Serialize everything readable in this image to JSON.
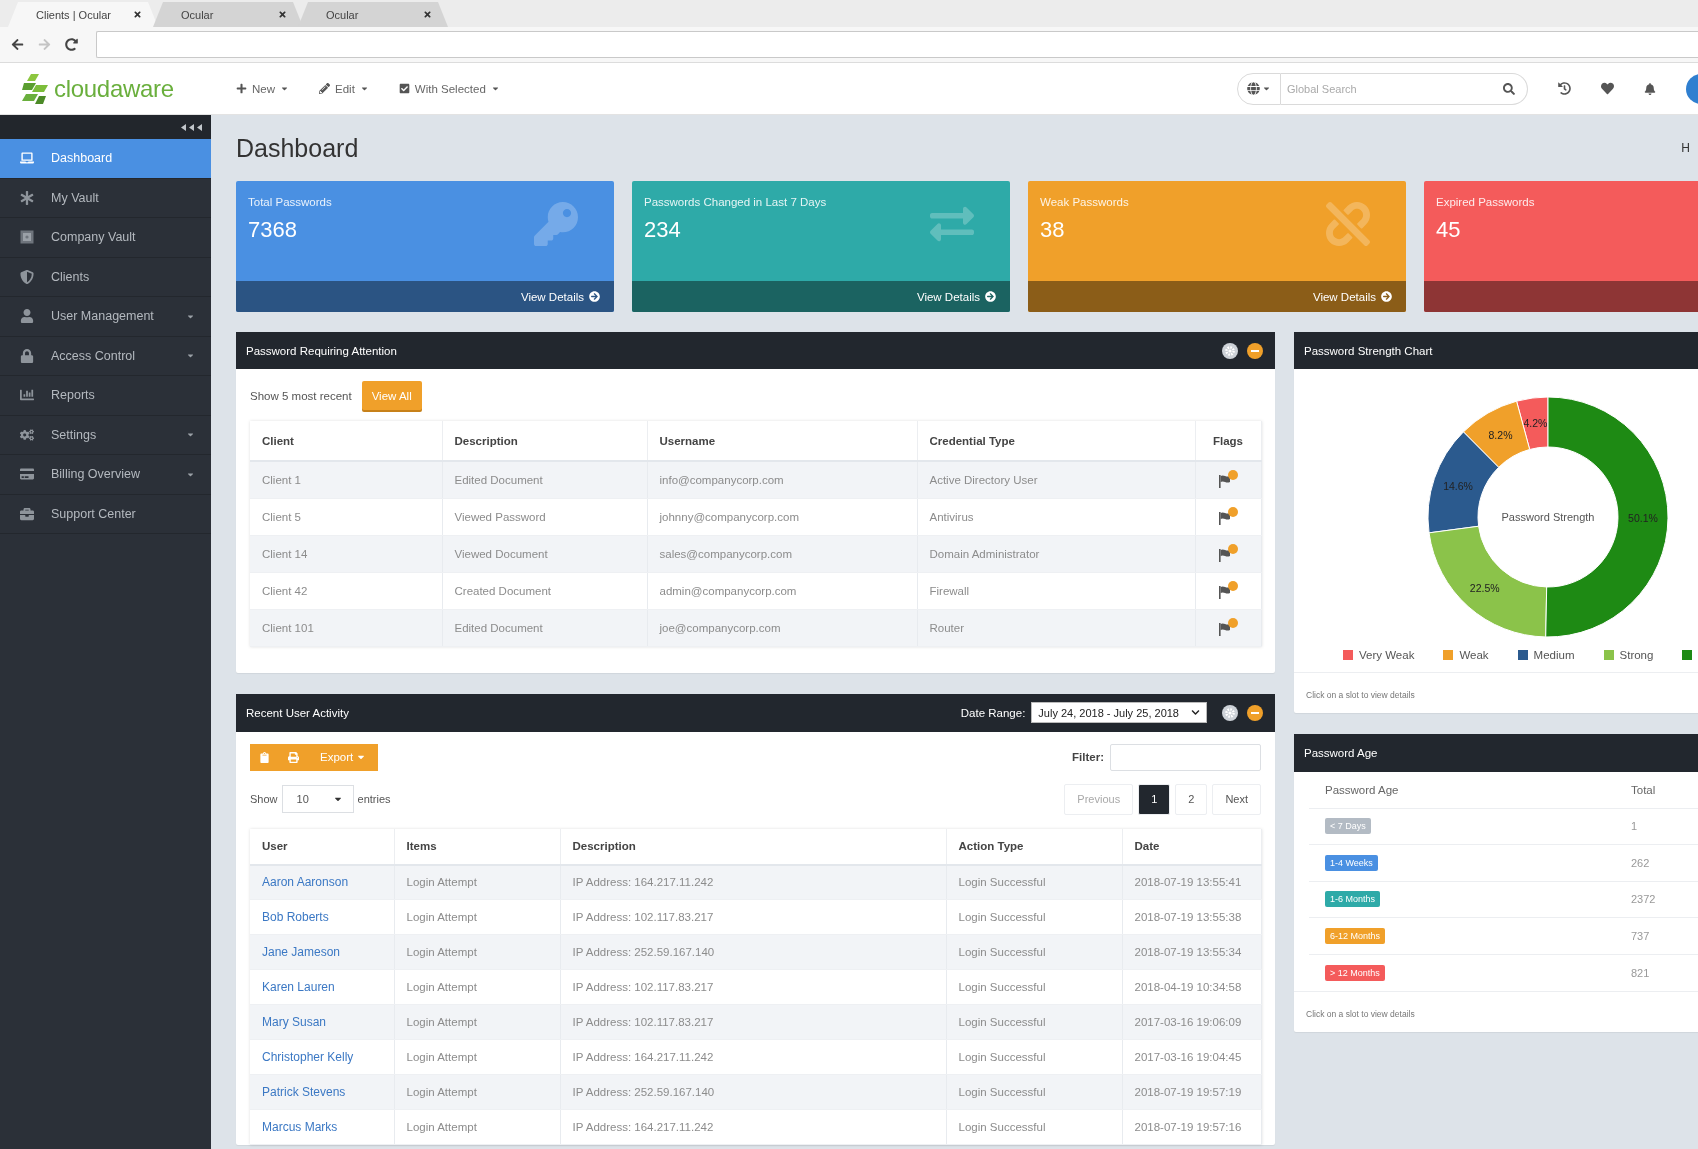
{
  "browser": {
    "tabs": [
      {
        "label": "Clients | Ocular",
        "selected": true
      },
      {
        "label": "Ocular",
        "selected": false
      },
      {
        "label": "Ocular",
        "selected": false
      }
    ],
    "nav_buttons": [
      {
        "kind": "back",
        "disabled": false
      },
      {
        "kind": "forward",
        "disabled": true
      },
      {
        "kind": "reload",
        "disabled": false
      }
    ]
  },
  "navbar": {
    "logo": "cloudaware",
    "menus": [
      {
        "kind": "new",
        "label": "New"
      },
      {
        "kind": "edit",
        "label": "Edit"
      },
      {
        "kind": "select",
        "label": "With Selected"
      }
    ],
    "search": {
      "placeholder": "Global Search"
    }
  },
  "sidebar": {
    "items": [
      {
        "kind": "dashboard",
        "label": "Dashboard",
        "selected": true,
        "expandable": false
      },
      {
        "kind": "vault",
        "label": "My Vault",
        "selected": false,
        "expandable": false
      },
      {
        "kind": "safe",
        "label": "Company Vault",
        "selected": false,
        "expandable": false
      },
      {
        "kind": "clients",
        "label": "Clients",
        "selected": false,
        "expandable": false
      },
      {
        "kind": "users",
        "label": "User Management",
        "selected": false,
        "expandable": true
      },
      {
        "kind": "access",
        "label": "Access Control",
        "selected": false,
        "expandable": true
      },
      {
        "kind": "reports",
        "label": "Reports",
        "selected": false,
        "expandable": false
      },
      {
        "kind": "settings",
        "label": "Settings",
        "selected": false,
        "expandable": true
      },
      {
        "kind": "billing",
        "label": "Billing Overview",
        "selected": false,
        "expandable": true
      },
      {
        "kind": "support",
        "label": "Support Center",
        "selected": false,
        "expandable": false
      }
    ]
  },
  "page": {
    "title": "Dashboard",
    "breadcrumb": "H"
  },
  "stat_cards": [
    {
      "kind": "key",
      "title": "Total Passwords",
      "value": "7368",
      "color": "#4a90e2",
      "link": "View Details"
    },
    {
      "kind": "exchange",
      "title": "Passwords Changed in Last 7 Days",
      "value": "234",
      "color": "#2eaaa8",
      "link": "View Details"
    },
    {
      "kind": "unlink",
      "title": "Weak Passwords",
      "value": "38",
      "color": "#f0a02a",
      "link": "View Details"
    },
    {
      "kind": "expired",
      "title": "Expired Passwords",
      "value": "45",
      "color": "#f45b5b"
    }
  ],
  "attention_panel": {
    "title": "Password Requiring Attention",
    "show_text": "Show 5 most recent",
    "view_all": "View All",
    "columns": [
      "Client",
      "Description",
      "Username",
      "Credential Type",
      "Flags"
    ],
    "rows": [
      {
        "client": "Client 1",
        "description": "Edited Document",
        "username": "info@companycorp.com",
        "credential_type": "Active Directory User"
      },
      {
        "client": "Client 5",
        "description": "Viewed Password",
        "username": "johnny@companycorp.com",
        "credential_type": "Antivirus"
      },
      {
        "client": "Client 14",
        "description": "Viewed Document",
        "username": "sales@companycorp.com",
        "credential_type": "Domain Administrator"
      },
      {
        "client": "Client 42",
        "description": "Created Document",
        "username": "admin@companycorp.com",
        "credential_type": "Firewall"
      },
      {
        "client": "Client 101",
        "description": "Edited Document",
        "username": "joe@companycorp.com",
        "credential_type": "Router"
      }
    ]
  },
  "activity_panel": {
    "title": "Recent User Activity",
    "date_range_label": "Date Range:",
    "date_range": "July 24, 2018 - July 25, 2018",
    "export": "Export",
    "filter_label": "Filter:",
    "show_label": "Show",
    "page_size": "10",
    "entries_label": "entries",
    "pagination": [
      {
        "label": "Previous",
        "selected": false,
        "disabled": true
      },
      {
        "label": "1",
        "selected": true,
        "disabled": false
      },
      {
        "label": "2",
        "selected": false,
        "disabled": false
      },
      {
        "label": "Next",
        "selected": false,
        "disabled": false
      }
    ],
    "columns": [
      "User",
      "Items",
      "Description",
      "Action Type",
      "Date"
    ],
    "rows": [
      {
        "user": "Aaron Aaronson",
        "items": "Login Attempt",
        "description": "IP Address: 164.217.11.242",
        "action_type": "Login Successful",
        "date": "2018-07-19 13:55:41"
      },
      {
        "user": "Bob Roberts",
        "items": "Login Attempt",
        "description": "IP Address: 102.117.83.217",
        "action_type": "Login Successful",
        "date": "2018-07-19 13:55:38"
      },
      {
        "user": "Jane Jameson",
        "items": "Login Attempt",
        "description": "IP Address: 252.59.167.140",
        "action_type": "Login Successful",
        "date": "2018-07-19 13:55:34"
      },
      {
        "user": "Karen Lauren",
        "items": "Login Attempt",
        "description": "IP Address: 102.117.83.217",
        "action_type": "Login Successful",
        "date": "2018-04-19 10:34:58"
      },
      {
        "user": "Mary Susan",
        "items": "Login Attempt",
        "description": "IP Address: 102.117.83.217",
        "action_type": "Login Successful",
        "date": "2017-03-16 19:06:09"
      },
      {
        "user": "Christopher Kelly",
        "items": "Login Attempt",
        "description": "IP Address: 164.217.11.242",
        "action_type": "Login Successful",
        "date": "2017-03-16 19:04:45"
      },
      {
        "user": "Patrick Stevens",
        "items": "Login Attempt",
        "description": "IP Address: 252.59.167.140",
        "action_type": "Login Successful",
        "date": "2018-07-19 19:57:19"
      },
      {
        "user": "Marcus Marks",
        "items": "Login Attempt",
        "description": "IP Address: 164.217.11.242",
        "action_type": "Login Successful",
        "date": "2018-07-19 19:57:16"
      }
    ]
  },
  "strength_panel": {
    "title": "Password Strength Chart",
    "chart_data": {
      "type": "donut",
      "title": "Password Strength",
      "values": [
        4.2,
        8.2,
        14.6,
        22.5,
        50.1
      ],
      "value_labels": [
        "4.2%",
        "8.2%",
        "14.6%",
        "22.5%",
        "50.1%"
      ]
    },
    "legend": [
      {
        "label": "Very Weak",
        "color": "#f45b5b"
      },
      {
        "label": "Weak",
        "color": "#f0a02a"
      },
      {
        "label": "Medium",
        "color": "#2b5a8e"
      },
      {
        "label": "Strong",
        "color": "#8bc34a"
      },
      {
        "color": "#1e8a14"
      }
    ],
    "footer": "Click on a slot to view details"
  },
  "age_panel": {
    "title": "Password Age",
    "columns": [
      "Password Age",
      "Total"
    ],
    "rows": [
      {
        "label": "< 7 Days",
        "color": "#b3bbc4",
        "total": "1"
      },
      {
        "label": "1-4 Weeks",
        "color": "#4a90e2",
        "total": "262"
      },
      {
        "label": "1-6 Months",
        "color": "#2eaaa8",
        "total": "2372"
      },
      {
        "label": "6-12 Months",
        "color": "#f0a02a",
        "total": "737"
      },
      {
        "label": "> 12 Months",
        "color": "#f45b5b",
        "total": "821"
      }
    ],
    "footer": "Click on a slot to view details"
  }
}
